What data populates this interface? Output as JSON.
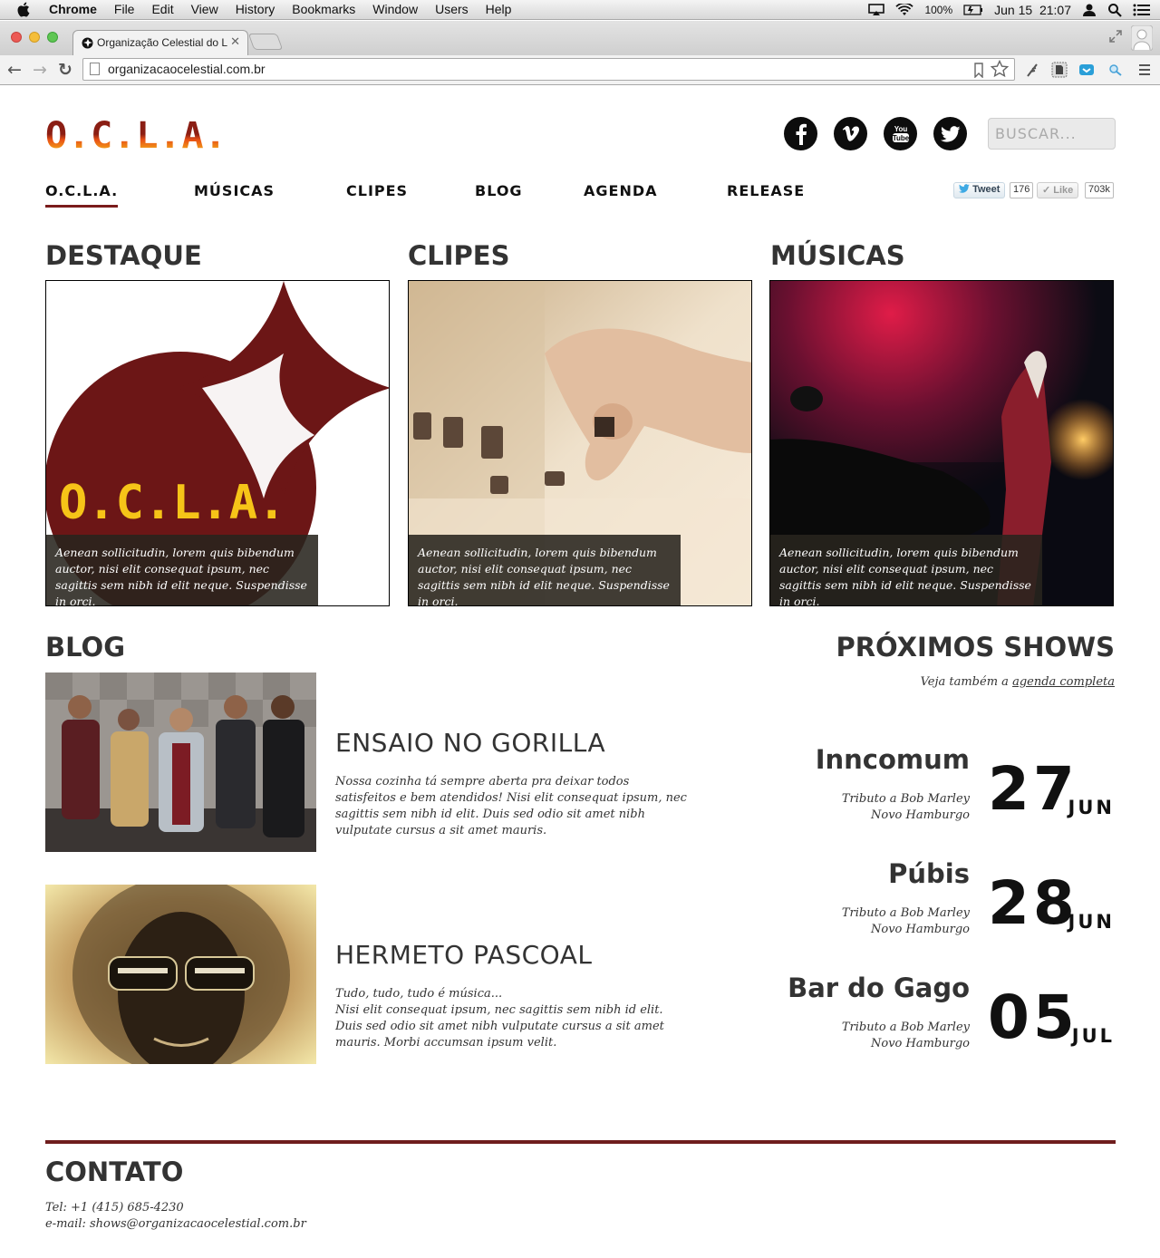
{
  "menubar": {
    "app": "Chrome",
    "items": [
      "File",
      "Edit",
      "View",
      "History",
      "Bookmarks",
      "Window",
      "Users",
      "Help"
    ],
    "battery": "100%",
    "clock": "Jun 15  21:07"
  },
  "browser": {
    "tab_title": "Organização Celestial do L",
    "url": "organizacaocelestial.com.br"
  },
  "site": {
    "logo": "O.C.L.A.",
    "search_placeholder": "BUSCAR...",
    "socials": [
      "facebook",
      "vimeo",
      "youtube",
      "twitter"
    ],
    "nav": [
      "O.C.L.A.",
      "MÚSICAS",
      "CLIPES",
      "BLOG",
      "AGENDA",
      "RELEASE"
    ],
    "active_nav": "O.C.L.A.",
    "share": {
      "tweet_label": "Tweet",
      "tweet_count": "176",
      "like_label": "Like",
      "like_count": "703k"
    }
  },
  "features": [
    {
      "heading": "DESTAQUE",
      "image": "ocla-logo-artwork",
      "logo_text": "O.C.L.A.",
      "caption": "Aenean sollicitudin, lorem quis bibendum auctor, nisi elit consequat ipsum, nec sagittis sem nibh id elit neque. Suspendisse in orci."
    },
    {
      "heading": "CLIPES",
      "image": "hand-on-mixer-knob",
      "caption": "Aenean sollicitudin, lorem quis bibendum auctor, nisi elit consequat ipsum, nec sagittis sem nibh id elit neque. Suspendisse in orci."
    },
    {
      "heading": "MÚSICAS",
      "image": "concert-crowd-red-light",
      "caption": "Aenean sollicitudin, lorem quis bibendum auctor, nisi elit consequat ipsum, nec sagittis sem nibh id elit neque. Suspendisse in orci."
    }
  ],
  "blog": {
    "heading": "BLOG",
    "posts": [
      {
        "title": "ENSAIO NO GORILLA",
        "image": "band-photo",
        "excerpt": "Nossa cozinha tá sempre aberta pra deixar todos satisfeitos e bem atendidos! Nisi elit consequat ipsum, nec sagittis sem nibh id elit. Duis sed odio sit amet nibh vulputate cursus a sit amet mauris."
      },
      {
        "title": "HERMETO PASCOAL",
        "image": "hermeto-portrait",
        "excerpt": "Tudo, tudo, tudo é música...\nNisi elit consequat ipsum, nec sagittis sem nibh id elit. Duis sed odio sit amet nibh vulputate cursus a sit amet mauris. Morbi accumsan ipsum velit."
      }
    ]
  },
  "shows": {
    "heading": "PRÓXIMOS SHOWS",
    "sub_prefix": "Veja também a",
    "sub_link": "agenda completa",
    "items": [
      {
        "venue": "Inncomum",
        "line1": "Tributo a Bob Marley",
        "line2": "Novo Hamburgo",
        "day": "27",
        "month": "JUN"
      },
      {
        "venue": "Púbis",
        "line1": "Tributo a Bob Marley",
        "line2": "Novo Hamburgo",
        "day": "28",
        "month": "JUN"
      },
      {
        "venue": "Bar do Gago",
        "line1": "Tributo a Bob Marley",
        "line2": "Novo Hamburgo",
        "day": "05",
        "month": "JUL"
      }
    ]
  },
  "contact": {
    "heading": "CONTATO",
    "phone": "Tel: +1 (415) 685-4230",
    "email": "e-mail: shows@organizacaocelestial.com.br"
  },
  "colors": {
    "brand": "#7a1c1c",
    "logo_yellow": "#f6c418",
    "text": "#333333"
  }
}
